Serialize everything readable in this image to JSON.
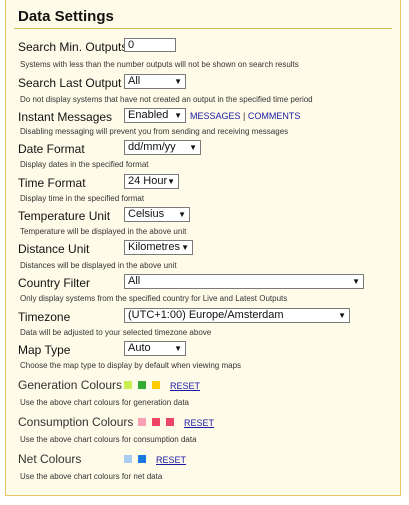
{
  "title": "Data Settings",
  "search_min_outputs": {
    "label": "Search Min. Outputs",
    "value": "0",
    "hint": "Systems with less than the number outputs will not be shown on search results"
  },
  "search_last_output": {
    "label": "Search Last Output",
    "value": "All",
    "hint": "Do not display systems that have not created an output in the specified time period"
  },
  "instant_messages": {
    "label": "Instant Messages",
    "value": "Enabled",
    "link_messages": "MESSAGES",
    "separator": "|",
    "link_comments": "COMMENTS",
    "hint": "Disabling messaging will prevent you from sending and receiving messages"
  },
  "date_format": {
    "label": "Date Format",
    "value": "dd/mm/yy",
    "hint": "Display dates in the specified format"
  },
  "time_format": {
    "label": "Time Format",
    "value": "24 Hour",
    "hint": "Display time in the specified format"
  },
  "temperature_unit": {
    "label": "Temperature Unit",
    "value": "Celsius",
    "hint": "Temperature will be displayed in the above unit"
  },
  "distance_unit": {
    "label": "Distance Unit",
    "value": "Kilometres",
    "hint": "Distances will be displayed in the above unit"
  },
  "country_filter": {
    "label": "Country Filter",
    "value": "All",
    "hint": "Only display systems from the specified country for Live and Latest Outputs"
  },
  "timezone": {
    "label": "Timezone",
    "value": "(UTC+1:00) Europe/Amsterdam",
    "hint": "Data will be adjusted to your selected timezone above"
  },
  "map_type": {
    "label": "Map Type",
    "value": "Auto",
    "hint": "Choose the map type to display by default when viewing maps"
  },
  "generation_colours": {
    "label": "Generation Colours",
    "colors": [
      "#ccee55",
      "#33aa33",
      "#ffcc00"
    ],
    "reset": "RESET",
    "hint": "Use the above chart colours for generation data"
  },
  "consumption_colours": {
    "label": "Consumption Colours",
    "colors": [
      "#f5a3b3",
      "#ee4466",
      "#ee4466"
    ],
    "reset": "RESET",
    "hint": "Use the above chart colours for consumption data"
  },
  "net_colours": {
    "label": "Net Colours",
    "colors": [
      "#a8cdf0",
      "#1a77dd"
    ],
    "reset": "RESET",
    "hint": "Use the above chart colours for net data"
  }
}
